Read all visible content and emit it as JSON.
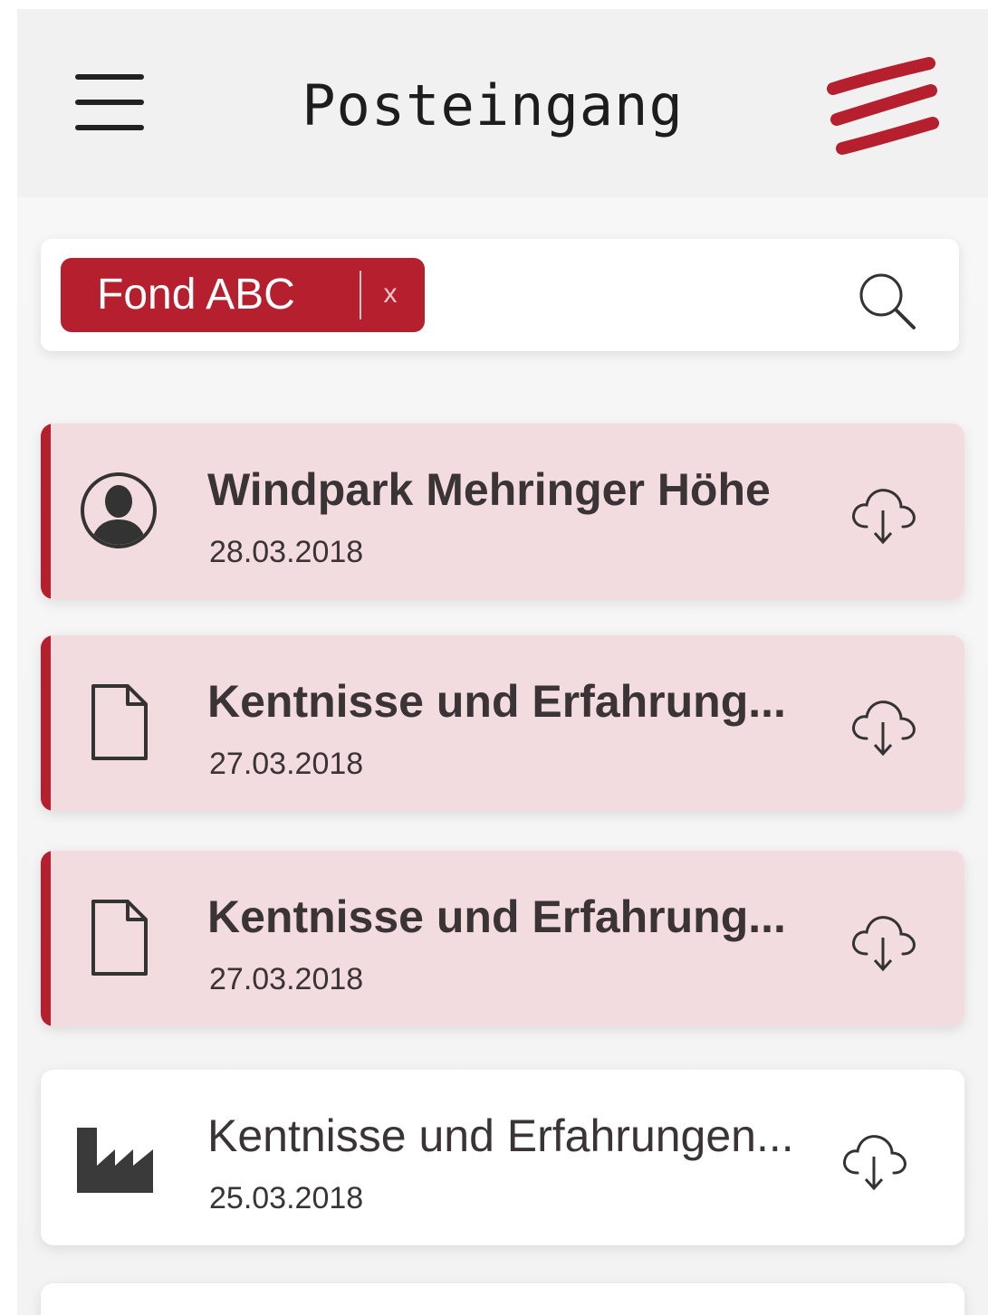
{
  "header": {
    "title": "Posteingang",
    "menu_icon": "hamburger-menu-icon",
    "logo_icon": "brand-logo-stripes",
    "brand_color": "#b51f2e"
  },
  "search": {
    "filter_chip": {
      "label": "Fond ABC",
      "remove_label": "x"
    },
    "icon": "search-icon"
  },
  "inbox": {
    "items": [
      {
        "title": "Windpark Mehringer Höhe",
        "date": "28.03.2018",
        "icon": "person-avatar-icon",
        "unread": true,
        "action_icon": "cloud-download-icon"
      },
      {
        "title": "Kentnisse und Erfahrung...",
        "date": "27.03.2018",
        "icon": "document-icon",
        "unread": true,
        "action_icon": "cloud-download-icon"
      },
      {
        "title": "Kentnisse und Erfahrung...",
        "date": "27.03.2018",
        "icon": "document-icon",
        "unread": true,
        "action_icon": "cloud-download-icon"
      },
      {
        "title": "Kentnisse und Erfahrungen...",
        "date": "25.03.2018",
        "icon": "factory-icon",
        "unread": false,
        "action_icon": "cloud-download-icon"
      }
    ]
  },
  "colors": {
    "accent": "#b51f2e",
    "unread_background": "#f3dcdf",
    "read_background": "#ffffff",
    "text": "#3a3436"
  }
}
